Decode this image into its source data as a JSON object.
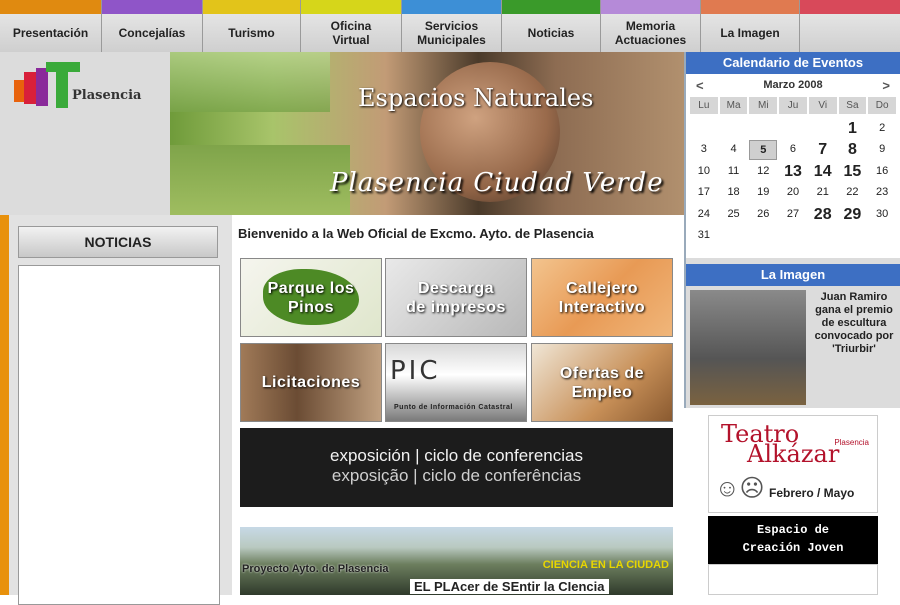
{
  "nav": [
    {
      "label": "Presentación",
      "color": "#e08a10"
    },
    {
      "label": "Concejalías",
      "color": "#8f55c8"
    },
    {
      "label": "Turismo",
      "color": "#e2c41a"
    },
    {
      "label": "Oficina\nVirtual",
      "color": "#d6d61a"
    },
    {
      "label": "Servicios\nMunicipales",
      "color": "#3d8fd6"
    },
    {
      "label": "Noticias",
      "color": "#3a9a2a"
    },
    {
      "label": "Memoria\nActuaciones",
      "color": "#b58ad8"
    },
    {
      "label": "La Imagen",
      "color": "#e07a50"
    },
    {
      "label": "",
      "color": "#d8495a"
    }
  ],
  "header": {
    "logo_text": "Plasencia",
    "banner_title": "Espacios Naturales",
    "banner_slogan": "Plasencia Ciudad Verde"
  },
  "calendar": {
    "title": "Calendario de Eventos",
    "month": "Marzo 2008",
    "prev": "<",
    "next": ">",
    "weekdays": [
      "Lu",
      "Ma",
      "Mi",
      "Ju",
      "Vi",
      "Sa",
      "Do"
    ],
    "days": [
      "",
      "",
      "",
      "",
      "",
      "1",
      "2",
      "3",
      "4",
      "5",
      "6",
      "7",
      "8",
      "9",
      "10",
      "11",
      "12",
      "13",
      "14",
      "15",
      "16",
      "17",
      "18",
      "19",
      "20",
      "21",
      "22",
      "23",
      "24",
      "25",
      "26",
      "27",
      "28",
      "29",
      "30",
      "31",
      "",
      "",
      "",
      "",
      "",
      ""
    ],
    "big_days": [
      "1",
      "7",
      "8",
      "13",
      "14",
      "15",
      "28",
      "29"
    ],
    "today": "5"
  },
  "left": {
    "noticias_title": "NOTICIAS"
  },
  "main": {
    "welcome": "Bienvenido a la Web Oficial de Excmo. Ayto. de Plasencia",
    "tiles": [
      {
        "id": "parque",
        "label": "Parque los\nPinos"
      },
      {
        "id": "descarga",
        "label": "Descarga\nde impresos"
      },
      {
        "id": "callejero",
        "label": "Callejero\nInteractivo"
      },
      {
        "id": "licitaciones",
        "label": "Licitaciones"
      },
      {
        "id": "pic",
        "label": "PIC",
        "sublabel": "Punto de Información Catastral"
      },
      {
        "id": "ofertas",
        "label": "Ofertas de\nEmpleo"
      }
    ],
    "expo_line1": "exposición | ciclo de conferencias",
    "expo_line2": "exposição | ciclo de conferências",
    "ciencia_caption": "Proyecto Ayto. de Plasencia",
    "ciencia_tag": "CIENCIA EN LA CIUDAD",
    "ciencia_slogan": "EL PLAcer de SEntir la CIencia"
  },
  "right": {
    "laimagen_title": "La Imagen",
    "laimagen_text": "Juan Ramiro gana el premio de escultura convocado por 'Triurbir'",
    "teatro_line1": "Teatro",
    "teatro_line2": "Alkázar",
    "teatro_city": "Plasencia",
    "teatro_dates": "Febrero / Mayo",
    "espacio_line1": "Espacio de",
    "espacio_line2": "Creación Joven"
  }
}
